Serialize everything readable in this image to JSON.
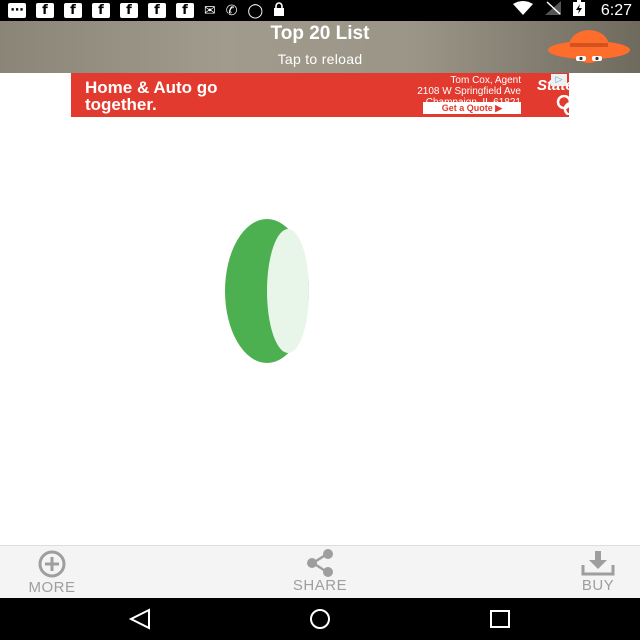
{
  "status_bar": {
    "left_icons": [
      "message-icon",
      "facebook-icon",
      "facebook-icon",
      "facebook-icon",
      "facebook-icon",
      "facebook-icon",
      "facebook-icon",
      "mail-icon",
      "no-fax-icon",
      "sync-icon",
      "lock-icon"
    ],
    "right_icons": [
      "wifi-icon",
      "no-signal-icon",
      "battery-charging-icon"
    ],
    "time": "6:27"
  },
  "header": {
    "title": "Top 20 List",
    "subtitle": "Tap to reload"
  },
  "ad": {
    "headline": "Home & Auto go together.",
    "agent_name": "Tom Cox, Agent",
    "address_line1": "2108 W Springfield Ave",
    "address_line2": "Champaign, IL 61821",
    "cta": "Get a Quote ▶",
    "brand": "StateFarm",
    "background": "#e23a2e"
  },
  "spinner": {
    "primary_color": "#4caf50",
    "face_color": "#e8f5e9"
  },
  "bottom_bar": {
    "more_label": "MORE",
    "share_label": "SHARE",
    "buy_label": "BUY"
  },
  "nav_bar": {
    "buttons": [
      "back-icon",
      "home-icon",
      "recents-icon"
    ]
  }
}
